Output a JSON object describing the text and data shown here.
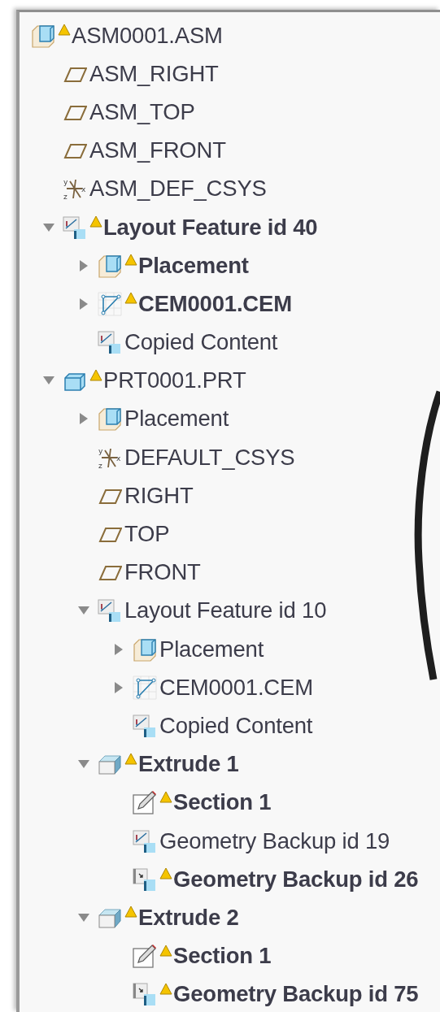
{
  "tree": {
    "items": [
      {
        "label": "ASM0001.ASM",
        "kind": "assembly",
        "warning": true,
        "bold": false,
        "children": [
          {
            "label": "ASM_RIGHT",
            "kind": "plane",
            "warning": false,
            "bold": false
          },
          {
            "label": "ASM_TOP",
            "kind": "plane",
            "warning": false,
            "bold": false
          },
          {
            "label": "ASM_FRONT",
            "kind": "plane",
            "warning": false,
            "bold": false
          },
          {
            "label": "ASM_DEF_CSYS",
            "kind": "csys",
            "axes": [
              "y",
              "z",
              "x"
            ],
            "warning": false,
            "bold": false
          },
          {
            "label": "Layout Feature id 40",
            "kind": "layout",
            "warning": true,
            "bold": true,
            "expanded": true,
            "children": [
              {
                "label": "Placement",
                "kind": "assembly",
                "warning": true,
                "bold": true,
                "expanded": false
              },
              {
                "label": "CEM0001.CEM",
                "kind": "cem",
                "warning": true,
                "bold": true,
                "expanded": false
              },
              {
                "label": "Copied Content",
                "kind": "layout",
                "warning": false,
                "bold": false
              }
            ]
          },
          {
            "label": "PRT0001.PRT",
            "kind": "part",
            "warning": true,
            "bold": false,
            "expanded": true,
            "children": [
              {
                "label": "Placement",
                "kind": "assembly",
                "warning": false,
                "bold": false,
                "expanded": false
              },
              {
                "label": "DEFAULT_CSYS",
                "kind": "csys",
                "axes": [
                  "y",
                  "z",
                  "x"
                ],
                "warning": false,
                "bold": false
              },
              {
                "label": "RIGHT",
                "kind": "plane",
                "warning": false,
                "bold": false
              },
              {
                "label": "TOP",
                "kind": "plane",
                "warning": false,
                "bold": false
              },
              {
                "label": "FRONT",
                "kind": "plane",
                "warning": false,
                "bold": false
              },
              {
                "label": "Layout Feature id 10",
                "kind": "layout",
                "warning": false,
                "bold": false,
                "expanded": true,
                "children": [
                  {
                    "label": "Placement",
                    "kind": "assembly",
                    "warning": false,
                    "bold": false,
                    "expanded": false
                  },
                  {
                    "label": "CEM0001.CEM",
                    "kind": "cem",
                    "warning": false,
                    "bold": false,
                    "expanded": false
                  },
                  {
                    "label": "Copied Content",
                    "kind": "layout",
                    "warning": false,
                    "bold": false
                  }
                ]
              },
              {
                "label": "Extrude 1",
                "kind": "extrude",
                "warning": true,
                "bold": true,
                "expanded": true,
                "children": [
                  {
                    "label": "Section 1",
                    "kind": "sketch",
                    "warning": true,
                    "bold": true
                  },
                  {
                    "label": "Geometry Backup id 19",
                    "kind": "layout",
                    "warning": false,
                    "bold": false
                  },
                  {
                    "label": "Geometry Backup id 26",
                    "kind": "backup",
                    "warning": true,
                    "bold": true
                  }
                ]
              },
              {
                "label": "Extrude 2",
                "kind": "extrude",
                "warning": true,
                "bold": true,
                "expanded": true,
                "children": [
                  {
                    "label": "Section 1",
                    "kind": "sketch",
                    "warning": true,
                    "bold": true
                  },
                  {
                    "label": "Geometry Backup id 75",
                    "kind": "backup",
                    "warning": true,
                    "bold": true
                  }
                ]
              }
            ]
          }
        ]
      }
    ]
  }
}
